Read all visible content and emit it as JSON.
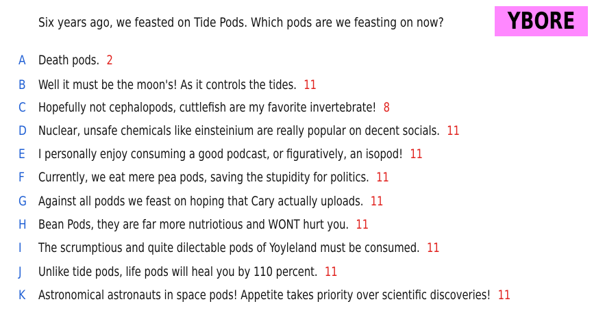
{
  "question": "Six years ago, we feasted on Tide Pods. Which pods are we feasting on now?",
  "logo_text": "YBORE",
  "colors": {
    "letter": "#1f5fd4",
    "votes": "#e0201c",
    "logo_background": "#ff88ff",
    "text": "#111111"
  },
  "answers": [
    {
      "letter": "A",
      "text": "Death pods.",
      "votes": "2"
    },
    {
      "letter": "B",
      "text": "Well it must be the moon's! As it controls the tides.",
      "votes": "11"
    },
    {
      "letter": "C",
      "text": "Hopefully not cephalopods, cuttlefish are my favorite invertebrate!",
      "votes": "8"
    },
    {
      "letter": "D",
      "text": "Nuclear, unsafe chemicals like einsteinium are really popular on decent socials.",
      "votes": "11"
    },
    {
      "letter": "E",
      "text": "I personally enjoy consuming a good podcast, or figuratively, an isopod!",
      "votes": "11"
    },
    {
      "letter": "F",
      "text": "Currently, we eat mere pea pods, saving the stupidity for politics.",
      "votes": "11"
    },
    {
      "letter": "G",
      "text": "Against all podds we feast on hoping that Cary actually uploads.",
      "votes": "11"
    },
    {
      "letter": "H",
      "text": "Bean Pods, they are far more nutriotious and WONT hurt you.",
      "votes": "11"
    },
    {
      "letter": "I",
      "text": "The scrumptious and quite dilectable pods of Yoyleland must be consumed.",
      "votes": "11"
    },
    {
      "letter": "J",
      "text": "Unlike tide pods, life pods will heal you by 110 percent.",
      "votes": "11"
    },
    {
      "letter": "K",
      "text": "Astronomical astronauts in space pods! Appetite takes priority over scientific discoveries!",
      "votes": "11"
    }
  ]
}
